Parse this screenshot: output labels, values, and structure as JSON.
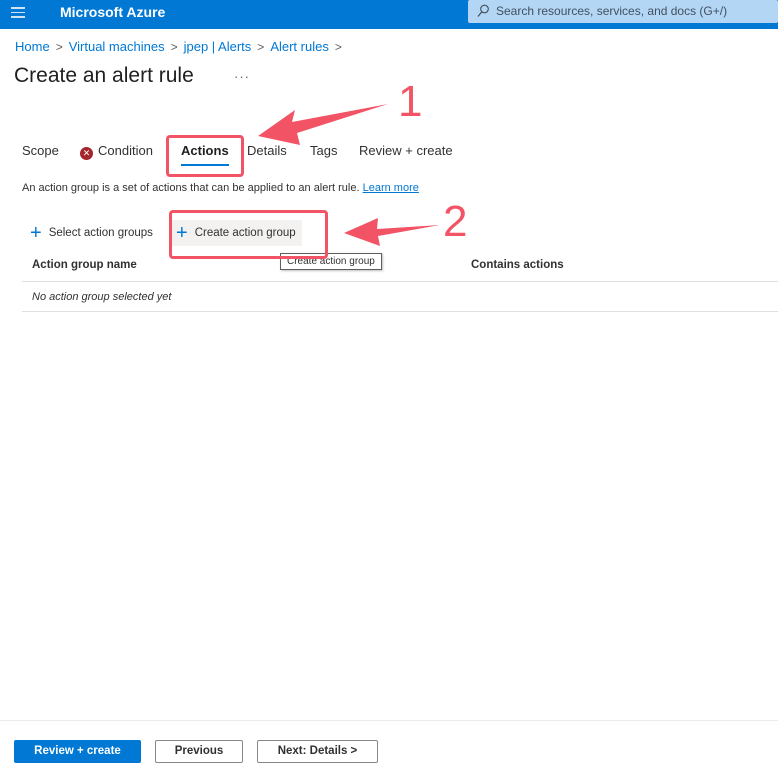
{
  "topbar": {
    "menu_icon": "hamburger-icon",
    "brand": "Microsoft Azure",
    "search_placeholder": "Search resources, services, and docs (G+/)",
    "search_icon": "search-icon",
    "bg_color": "#0078d4"
  },
  "breadcrumb": [
    {
      "label": "Home"
    },
    {
      "label": "Virtual machines"
    },
    {
      "label": "jpep | Alerts"
    },
    {
      "label": "Alert rules"
    }
  ],
  "breadcrumb_separator": ">",
  "page": {
    "title": "Create an alert rule",
    "more_label": "···"
  },
  "tabs": [
    {
      "label": "Scope",
      "active": false
    },
    {
      "label": "Condition",
      "active": false,
      "error": true
    },
    {
      "label": "Actions",
      "active": true
    },
    {
      "label": "Details",
      "active": false
    },
    {
      "label": "Tags",
      "active": false
    },
    {
      "label": "Review + create",
      "active": false
    }
  ],
  "description": {
    "text": "An action group is a set of actions that can be applied to an alert rule.",
    "link": "Learn more"
  },
  "commands": {
    "select_action_groups": "Select action groups",
    "create_action_group": "Create action group",
    "tooltip": "Create action group"
  },
  "table": {
    "columns": [
      "Action group name",
      "Contains actions"
    ],
    "empty_text": "No action group selected yet"
  },
  "footer": {
    "review_create": "Review + create",
    "previous": "Previous",
    "next": "Next: Details >"
  },
  "annotations": {
    "label_1": "1",
    "label_2": "2",
    "color": "#f25466"
  }
}
